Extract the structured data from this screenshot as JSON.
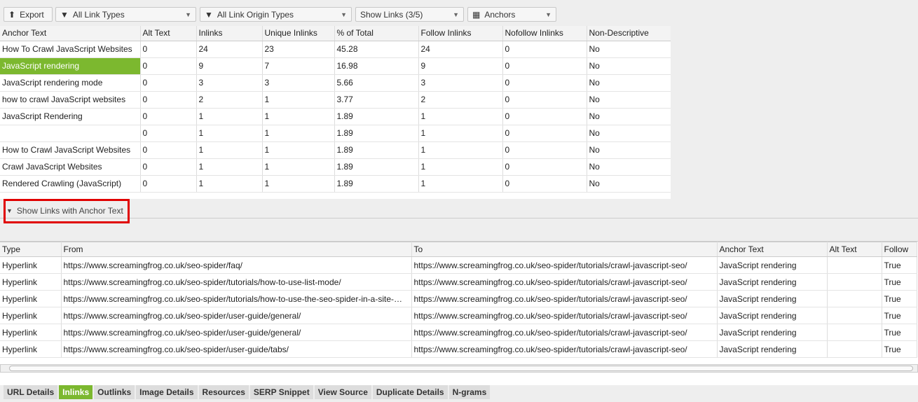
{
  "toolbar": {
    "export": "Export",
    "link_types": "All Link Types",
    "origin_types": "All Link Origin Types",
    "show_links": "Show Links (3/5)",
    "anchors": "Anchors"
  },
  "top_table": {
    "headers": [
      "Anchor Text",
      "Alt Text",
      "Inlinks",
      "Unique Inlinks",
      "% of Total",
      "Follow Inlinks",
      "Nofollow Inlinks",
      "Non-Descriptive"
    ],
    "rows": [
      [
        "How To Crawl JavaScript Websites",
        "0",
        "24",
        "23",
        "45.28",
        "24",
        "0",
        "No"
      ],
      [
        "JavaScript rendering",
        "0",
        "9",
        "7",
        "16.98",
        "9",
        "0",
        "No"
      ],
      [
        "JavaScript rendering mode",
        "0",
        "3",
        "3",
        "5.66",
        "3",
        "0",
        "No"
      ],
      [
        "how to crawl JavaScript websites",
        "0",
        "2",
        "1",
        "3.77",
        "2",
        "0",
        "No"
      ],
      [
        "JavaScript Rendering",
        "0",
        "1",
        "1",
        "1.89",
        "1",
        "0",
        "No"
      ],
      [
        "",
        "0",
        "1",
        "1",
        "1.89",
        "1",
        "0",
        "No"
      ],
      [
        "How to Crawl JavaScript Websites",
        "0",
        "1",
        "1",
        "1.89",
        "1",
        "0",
        "No"
      ],
      [
        "Crawl JavaScript Websites",
        "0",
        "1",
        "1",
        "1.89",
        "1",
        "0",
        "No"
      ],
      [
        "Rendered Crawling (JavaScript)",
        "0",
        "1",
        "1",
        "1.89",
        "1",
        "0",
        "No"
      ]
    ],
    "selected_row": 1
  },
  "toggle": {
    "label": "Show Links with Anchor Text"
  },
  "bottom_table": {
    "headers": [
      "Type",
      "From",
      "To",
      "Anchor Text",
      "Alt Text",
      "Follow"
    ],
    "rows": [
      [
        "Hyperlink",
        "https://www.screamingfrog.co.uk/seo-spider/faq/",
        "https://www.screamingfrog.co.uk/seo-spider/tutorials/crawl-javascript-seo/",
        "JavaScript rendering",
        "",
        "True"
      ],
      [
        "Hyperlink",
        "https://www.screamingfrog.co.uk/seo-spider/tutorials/how-to-use-list-mode/",
        "https://www.screamingfrog.co.uk/seo-spider/tutorials/crawl-javascript-seo/",
        "JavaScript rendering",
        "",
        "True"
      ],
      [
        "Hyperlink",
        "https://www.screamingfrog.co.uk/seo-spider/tutorials/how-to-use-the-seo-spider-in-a-site-migration/",
        "https://www.screamingfrog.co.uk/seo-spider/tutorials/crawl-javascript-seo/",
        "JavaScript rendering",
        "",
        "True"
      ],
      [
        "Hyperlink",
        "https://www.screamingfrog.co.uk/seo-spider/user-guide/general/",
        "https://www.screamingfrog.co.uk/seo-spider/tutorials/crawl-javascript-seo/",
        "JavaScript rendering",
        "",
        "True"
      ],
      [
        "Hyperlink",
        "https://www.screamingfrog.co.uk/seo-spider/user-guide/general/",
        "https://www.screamingfrog.co.uk/seo-spider/tutorials/crawl-javascript-seo/",
        "JavaScript rendering",
        "",
        "True"
      ],
      [
        "Hyperlink",
        "https://www.screamingfrog.co.uk/seo-spider/user-guide/tabs/",
        "https://www.screamingfrog.co.uk/seo-spider/tutorials/crawl-javascript-seo/",
        "JavaScript rendering",
        "",
        "True"
      ]
    ]
  },
  "tabs": [
    "URL Details",
    "Inlinks",
    "Outlinks",
    "Image Details",
    "Resources",
    "SERP Snippet",
    "View Source",
    "Duplicate Details",
    "N-grams"
  ],
  "active_tab": "Inlinks",
  "colors": {
    "accent": "#7cb82f",
    "highlight_box": "#e00000"
  }
}
